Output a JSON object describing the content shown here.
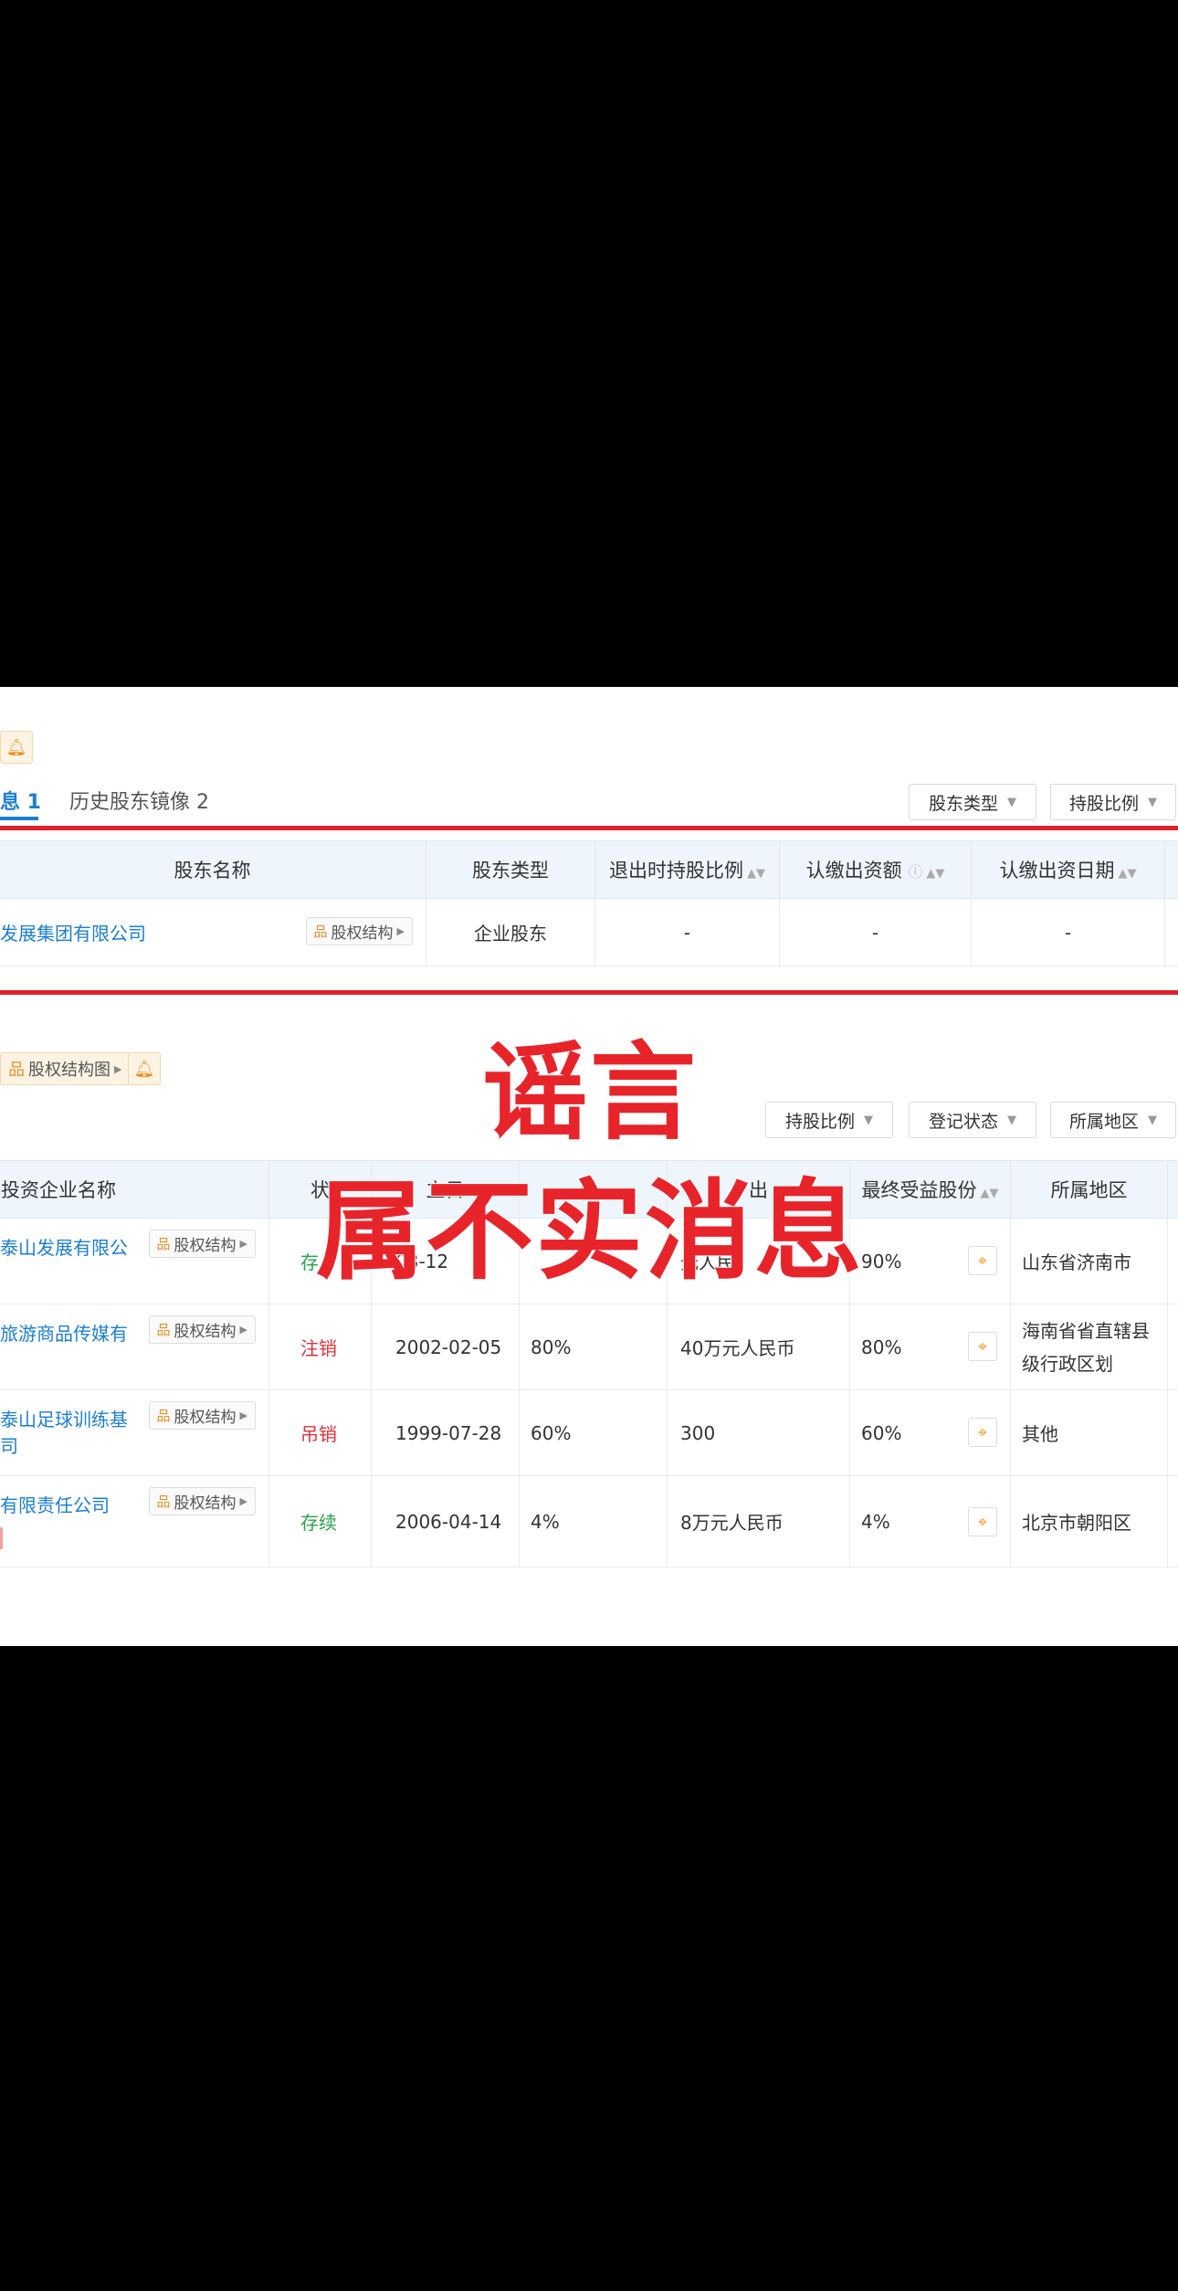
{
  "top_section": {
    "bell_icon": "bell-icon",
    "tabs": [
      {
        "label": "息 1",
        "active": true
      },
      {
        "label": "历史股东镜像 2",
        "active": false
      }
    ],
    "filters": [
      "股东类型",
      "持股比例"
    ],
    "table": {
      "headers": [
        "股东名称",
        "股东类型",
        "退出时持股比例",
        "认缴出资额",
        "认缴出资日期"
      ],
      "rows": [
        {
          "name": "发展集团有限公司",
          "struct_label": "股权结构",
          "type": "企业股东",
          "ratio": "-",
          "amount": "-",
          "date": "-"
        }
      ]
    }
  },
  "bottom_section": {
    "struct_button": "股权结构图",
    "filters": [
      "持股比例",
      "登记状态",
      "所属地区"
    ],
    "table": {
      "headers": [
        "投资企业名称",
        "状",
        "立日",
        "出",
        "最终受益股份",
        "所属地区"
      ],
      "rows": [
        {
          "name": "泰山发展有限公",
          "struct_label": "股权结构",
          "status": "存",
          "status_color": "green",
          "date": "03-12",
          "ratio": "",
          "capital": "元人民",
          "benefit": "90%",
          "region": "山东省济南市"
        },
        {
          "name": "旅游商品传媒有",
          "struct_label": "股权结构",
          "status": "注销",
          "status_color": "red",
          "date": "2002-02-05",
          "ratio": "80%",
          "capital": "40万元人民币",
          "benefit": "80%",
          "region": "海南省省直辖县级行政区划"
        },
        {
          "name": "泰山足球训练基",
          "name2": "司",
          "struct_label": "股权结构",
          "status": "吊销",
          "status_color": "red",
          "date": "1999-07-28",
          "ratio": "60%",
          "capital": "300",
          "benefit": "60%",
          "region": "其他"
        },
        {
          "name": "有限责任公司",
          "struct_label": "股权结构",
          "status": "存续",
          "status_color": "green",
          "date": "2006-04-14",
          "ratio": "4%",
          "capital": "8万元人民币",
          "benefit": "4%",
          "region": "北京市朝阳区"
        }
      ]
    }
  },
  "overlay_text": {
    "line1": "谣言",
    "line2": "属不实消息"
  },
  "colors": {
    "accent": "#1a7fd4",
    "alert_red": "#e0202a",
    "header_bg": "#eef5fc"
  }
}
